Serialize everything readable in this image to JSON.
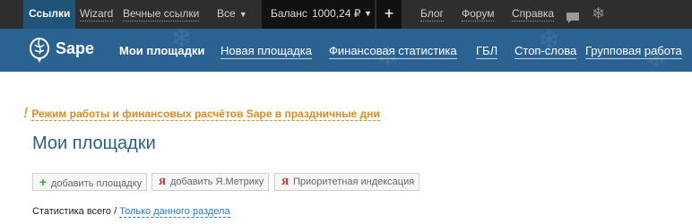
{
  "topbar": {
    "links": "Ссылки",
    "wizard": "Wizard",
    "eternal": "Вечные ссылки",
    "all": "Все",
    "balance_label": "Баланс",
    "balance_value": "1000,24 ₽",
    "plus": "+",
    "blog": "Блог",
    "forum": "Форум",
    "help": "Справка"
  },
  "nav": {
    "brand": "Sape",
    "my_sites": "Мои площадки",
    "new_site": "Новая площадка",
    "finance": "Финансовая статистика",
    "gbl": "ГБЛ",
    "stop_words": "Стоп-слова",
    "group_work": "Групповая работа"
  },
  "notice": {
    "mark": "!",
    "text": "Режим работы и финансовых расчётов Sape в праздничные дни"
  },
  "page": {
    "title": "Мои площадки"
  },
  "buttons": {
    "add_site": "добавить площадку",
    "add_metrika": "добавить Я.Метрику",
    "priority_index": "Приоритетная индексация",
    "ya_glyph": "Я"
  },
  "stats": {
    "all_label": "Статистика всего /",
    "section_link": "Только данного раздела"
  },
  "colors": {
    "topbar_bg": "#2e2e2e",
    "nav_bg": "#2a6391",
    "accent_orange": "#e38b1f",
    "title_blue": "#2c5f87"
  }
}
